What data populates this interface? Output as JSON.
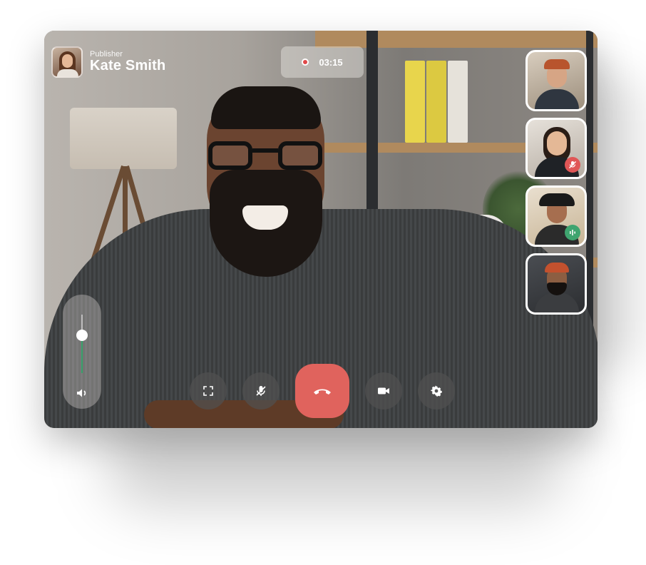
{
  "publisher": {
    "role": "Publisher",
    "name": "Kate Smith",
    "avatar_icon": "user-avatar"
  },
  "timer": {
    "recording_icon": "record-dot-icon",
    "elapsed": "03:15"
  },
  "participants": [
    {
      "id": "participant-1",
      "status": "none"
    },
    {
      "id": "participant-2",
      "status": "muted",
      "badge_icon": "mic-off-icon",
      "badge_color": "#e05656"
    },
    {
      "id": "participant-3",
      "status": "speaking",
      "badge_icon": "audio-wave-icon",
      "badge_color": "#3fa46f"
    },
    {
      "id": "participant-4",
      "status": "none"
    }
  ],
  "volume": {
    "level": 0.65,
    "icon": "speaker-icon",
    "accent": "#37a06a"
  },
  "controls": [
    {
      "name": "fullscreen",
      "icon": "expand-icon"
    },
    {
      "name": "mute",
      "icon": "mic-off-icon"
    },
    {
      "name": "end-call",
      "icon": "phone-hangup-icon",
      "color": "#e0635d"
    },
    {
      "name": "video",
      "icon": "video-camera-icon"
    },
    {
      "name": "settings",
      "icon": "gear-icon"
    }
  ]
}
